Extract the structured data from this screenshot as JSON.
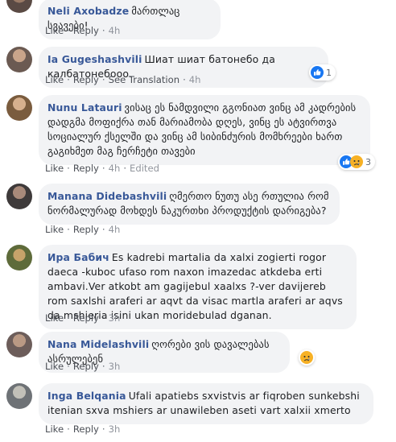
{
  "labels": {
    "like": "Like",
    "reply": "Reply",
    "see_translation": "See Translation",
    "edited": "Edited"
  },
  "comments": [
    {
      "author": "Neli Axobadze",
      "text": "მართლაც სვავები!",
      "time": "4h"
    },
    {
      "author": "Ia Gugeshashvili",
      "text": "Шиат шиат батонебо да калбатонебооо.",
      "time": "4h",
      "reaction_count": "1",
      "reactions": [
        "like-icon"
      ]
    },
    {
      "author": "Nunu Latauri",
      "text": "ვისაც ეს ნამდვილი გგონიათ ვინც ამ კადრების დადგმა მოფიქრა თან მარიამობა დღეს, ვინც ეს ატვირთვა სოციალურ ქსელში და ვინც ამ სიბინძურის მომხრეები ხართ გაგიხმეთ მაგ ჩერჩეტი თავები",
      "time": "4h",
      "reaction_count": "3",
      "reactions": [
        "like-icon",
        "sad-icon"
      ]
    },
    {
      "author": "Manana Didebashvili",
      "text": "ღმერთო ნუთუ ასე რთულია რომ ნორმალურად მოხდეს ნაკურთხი პროდუქტის დარიგება?",
      "time": "4h"
    },
    {
      "author": "Ира Бабич",
      "text": "Es kadrebi martalia da xalxi zogierti rogor daeca -kuboc ufaso rom naxon imazedac atkdeba erti ambavi.Ver atkobt am gagijebul xaalxs ?-ver davijereb rom saxlshi araferi ar aqvt da visac martla araferi ar aqvs da mshieria isini ukan moridebulad dganan.",
      "time": "3h"
    },
    {
      "author": "Nana Midelashvili",
      "text": "ღორები ვის დავალებას ასრულებენ",
      "time": "3h",
      "reactions": [
        "sad-icon"
      ]
    },
    {
      "author": "Inga Belqania",
      "text": "Ufali apatiebs sxvistvis ar fiqroben sunkebshi itenian sxva mshiers ar unawileben aseti vart xalxii xmerto",
      "time": "3h"
    }
  ],
  "colors": {
    "author": "#385898",
    "bubble": "#f2f3f5",
    "like": "#1877f2",
    "sad": "#f7b125"
  }
}
